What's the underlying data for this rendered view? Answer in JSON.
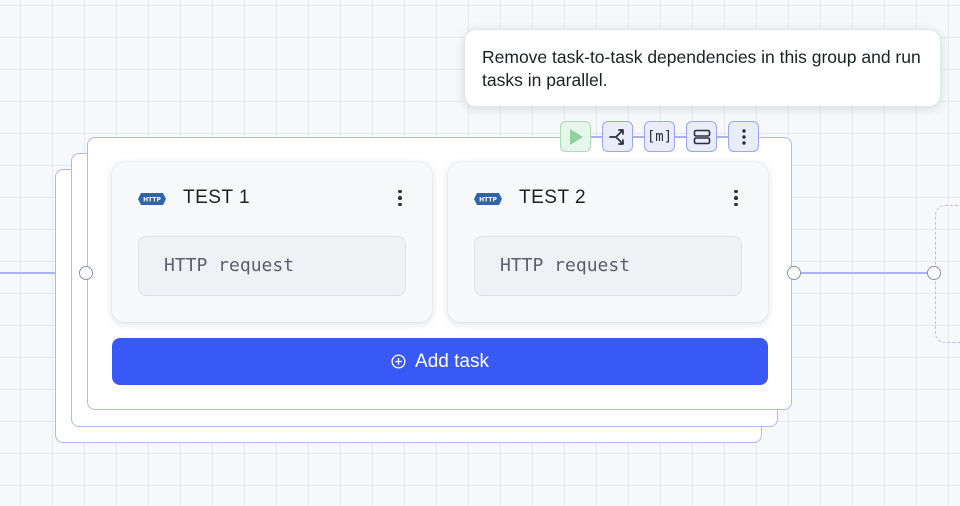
{
  "tooltip": {
    "text": "Remove task-to-task dependencies in this group and run tasks in parallel."
  },
  "toolbar": {
    "buttons": [
      {
        "icon": "play-icon"
      },
      {
        "icon": "parallel-branch-icon"
      },
      {
        "icon": "matrix-brackets-icon",
        "label": "[m]"
      },
      {
        "icon": "layers-icon"
      },
      {
        "icon": "more-vertical-icon"
      }
    ]
  },
  "tasks": [
    {
      "title": "TEST 1",
      "subtitle": "HTTP request",
      "icon": "http-icon",
      "icon_text": "HTTP"
    },
    {
      "title": "TEST 2",
      "subtitle": "HTTP request",
      "icon": "http-icon",
      "icon_text": "HTTP"
    }
  ],
  "add_task": {
    "label": "Add task",
    "icon": "plus-circle-icon"
  },
  "colors": {
    "accent": "#3959f6",
    "group_border": "#aeb8f3",
    "run_green": "#8fd19e",
    "http_badge": "#2f63b0"
  }
}
